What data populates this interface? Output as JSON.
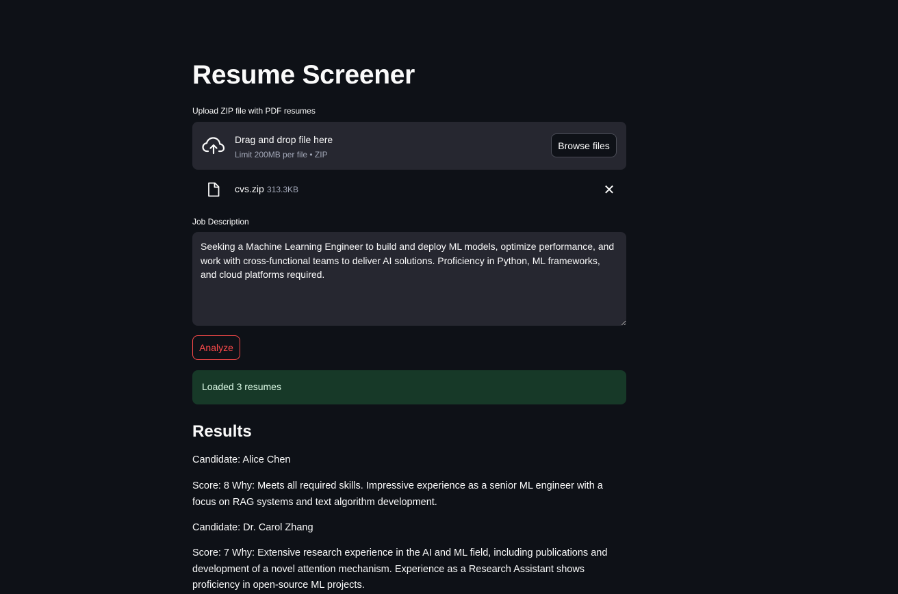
{
  "app": {
    "title": "Resume Screener"
  },
  "uploader": {
    "label": "Upload ZIP file with PDF resumes",
    "drag_text": "Drag and drop file here",
    "limit_text": "Limit 200MB per file • ZIP",
    "browse_label": "Browse files",
    "icon": "cloud-upload-icon"
  },
  "uploaded_file": {
    "name": "cvs.zip",
    "size": "313.3KB",
    "icon": "file-icon",
    "remove_icon": "close-icon",
    "remove_glyph": "✕"
  },
  "job_description": {
    "label": "Job Description",
    "value": "Seeking a Machine Learning Engineer to build and deploy ML models, optimize performance, and work with cross-functional teams to deliver AI solutions. Proficiency in Python, ML frameworks, and cloud platforms required."
  },
  "analyze": {
    "label": "Analyze"
  },
  "status": {
    "message": "Loaded 3 resumes"
  },
  "results": {
    "heading": "Results",
    "items": [
      {
        "candidate": "Candidate: Alice Chen",
        "detail": "Score: 8 Why: Meets all required skills. Impressive experience as a senior ML engineer with a focus on RAG systems and text algorithm development."
      },
      {
        "candidate": "Candidate: Dr. Carol Zhang",
        "detail": "Score: 7 Why: Extensive research experience in the AI and ML field, including publications and development of a novel attention mechanism. Experience as a Research Assistant shows proficiency in open-source ML projects."
      }
    ]
  },
  "colors": {
    "background": "#0e1117",
    "surface": "#262730",
    "accent": "#ff4b4b",
    "success_bg": "#173928",
    "success_text": "#dffde9"
  }
}
